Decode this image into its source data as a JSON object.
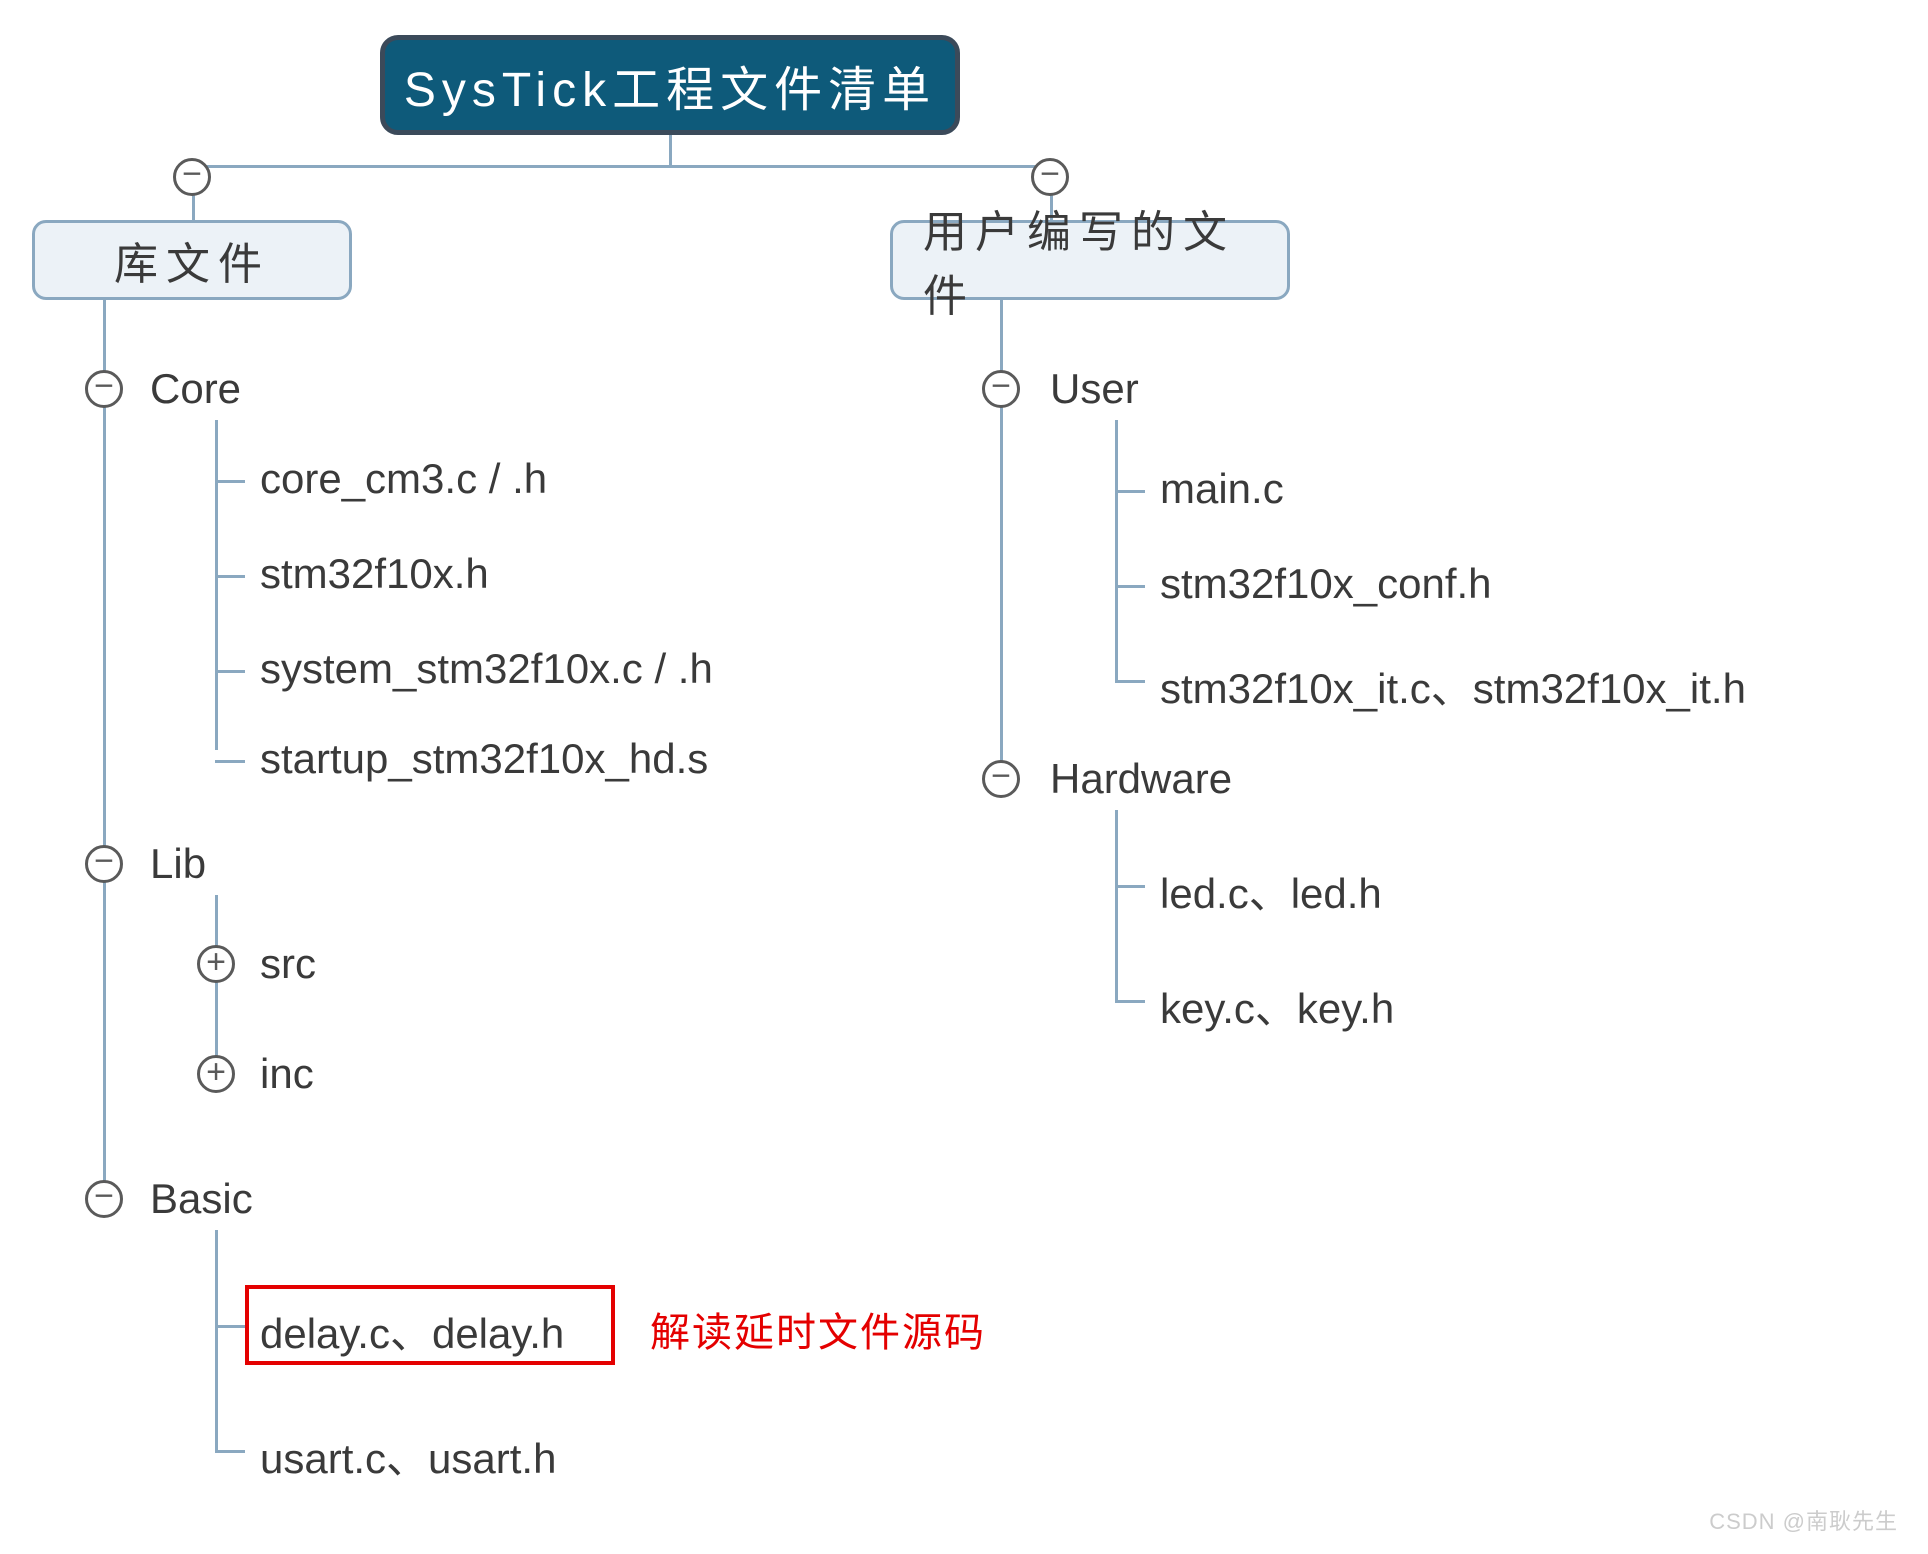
{
  "root": {
    "title": "SysTick工程文件清单"
  },
  "left_branch": {
    "label": "库文件",
    "nodes": {
      "core": {
        "label": "Core",
        "items": [
          "core_cm3.c / .h",
          "stm32f10x.h",
          "system_stm32f10x.c / .h",
          "startup_stm32f10x_hd.s"
        ]
      },
      "lib": {
        "label": "Lib",
        "items": [
          "src",
          "inc"
        ]
      },
      "basic": {
        "label": "Basic",
        "items": [
          "delay.c、delay.h",
          "usart.c、usart.h"
        ]
      }
    }
  },
  "right_branch": {
    "label": "用户编写的文件",
    "nodes": {
      "user": {
        "label": "User",
        "items": [
          "main.c",
          "stm32f10x_conf.h",
          "stm32f10x_it.c、stm32f10x_it.h"
        ]
      },
      "hardware": {
        "label": "Hardware",
        "items": [
          "led.c、led.h",
          "key.c、key.h"
        ]
      }
    }
  },
  "annotation": {
    "text": "解读延时文件源码"
  },
  "watermark": "CSDN @南耿先生"
}
